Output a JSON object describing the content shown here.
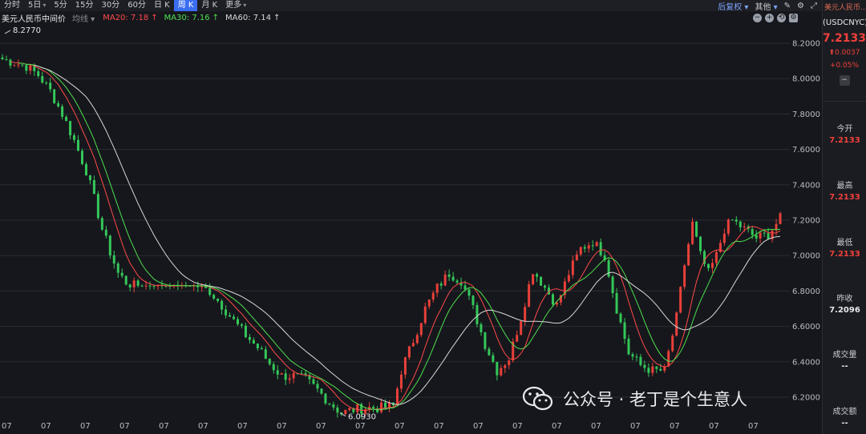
{
  "toolbar": {
    "items": [
      {
        "label": "分时",
        "caret": false,
        "active": false
      },
      {
        "label": "5日",
        "caret": true,
        "active": false
      },
      {
        "label": "5分",
        "caret": false,
        "active": false
      },
      {
        "label": "15分",
        "caret": false,
        "active": false
      },
      {
        "label": "30分",
        "caret": false,
        "active": false
      },
      {
        "label": "60分",
        "caret": false,
        "active": false
      },
      {
        "label": "日 K",
        "caret": false,
        "active": false
      },
      {
        "label": "周 K",
        "caret": false,
        "active": true
      },
      {
        "label": "月 K",
        "caret": false,
        "active": false
      },
      {
        "label": "更多",
        "caret": true,
        "active": false
      }
    ],
    "fuquan": "后复权",
    "other": "其他"
  },
  "legend": {
    "name": "美元人民币中间价",
    "avg": "均线",
    "ma": [
      {
        "label": "MA20: 7.18",
        "arrow": "↑",
        "color": "#ff4a4a"
      },
      {
        "label": "MA30: 7.16",
        "arrow": "↑",
        "color": "#4ee04e"
      },
      {
        "label": "MA60: 7.14",
        "arrow": "↑",
        "color": "#d8d8d8"
      }
    ]
  },
  "sidebar": {
    "name": "美元人民币...",
    "code": "(USDCNYC)",
    "price": "7.2133",
    "change": "⬆0.0037",
    "change_pct": "+0.05%",
    "fields": [
      {
        "label": "今开",
        "value": "7.2133",
        "color": "red"
      },
      {
        "label": "最高",
        "value": "7.2133",
        "color": "red"
      },
      {
        "label": "最低",
        "value": "7.2133",
        "color": "red"
      },
      {
        "label": "昨收",
        "value": "7.2096",
        "color": "white"
      },
      {
        "label": "成交量",
        "value": "--",
        "color": "white"
      },
      {
        "label": "成交额",
        "value": "--",
        "color": "white"
      }
    ]
  },
  "watermark": "公众号 · 老丁是个生意人",
  "colors": {
    "up": "#e8403a",
    "down": "#34c759",
    "ma20": "#ff4a4a",
    "ma30": "#4ee04e",
    "ma60": "#d8d8d8",
    "bg": "#16171c",
    "grid": "#2a2c33"
  },
  "chart_data": {
    "type": "candlestick",
    "ylim": [
      6.06,
      8.3
    ],
    "y_ticks": [
      "8.2000",
      "8.0000",
      "7.8000",
      "7.6000",
      "7.4000",
      "7.2000",
      "7.0000",
      "6.8000",
      "6.6000",
      "6.4000",
      "6.2000"
    ],
    "x_ticks": [
      "07",
      "07",
      "07",
      "07",
      "07",
      "07",
      "07",
      "07",
      "07",
      "07",
      "07",
      "07",
      "07",
      "07",
      "07",
      "07",
      "07",
      "07",
      "07",
      "07"
    ],
    "annotations": [
      {
        "label": "8.2770",
        "value": 8.277,
        "marker": "max"
      },
      {
        "label": "6.0930",
        "value": 6.093,
        "marker": "min"
      }
    ],
    "close_path": [
      [
        0,
        8.11
      ],
      [
        3,
        8.09
      ],
      [
        6,
        8.07
      ],
      [
        9,
        8.02
      ],
      [
        12,
        7.93
      ],
      [
        15,
        7.8
      ],
      [
        18,
        7.65
      ],
      [
        21,
        7.48
      ],
      [
        23,
        7.32
      ],
      [
        25,
        7.15
      ],
      [
        27,
        7.02
      ],
      [
        29,
        6.9
      ],
      [
        31,
        6.85
      ],
      [
        33,
        6.83
      ],
      [
        40,
        6.83
      ],
      [
        48,
        6.83
      ],
      [
        52,
        6.8
      ],
      [
        55,
        6.72
      ],
      [
        58,
        6.63
      ],
      [
        61,
        6.55
      ],
      [
        64,
        6.48
      ],
      [
        67,
        6.39
      ],
      [
        70,
        6.32
      ],
      [
        73,
        6.32
      ],
      [
        76,
        6.3
      ],
      [
        79,
        6.24
      ],
      [
        82,
        6.17
      ],
      [
        85,
        6.11
      ],
      [
        88,
        6.13
      ],
      [
        91,
        6.14
      ],
      [
        95,
        6.14
      ],
      [
        98,
        6.15
      ],
      [
        100,
        6.35
      ],
      [
        103,
        6.52
      ],
      [
        106,
        6.7
      ],
      [
        109,
        6.82
      ],
      [
        112,
        6.9
      ],
      [
        115,
        6.86
      ],
      [
        118,
        6.7
      ],
      [
        121,
        6.5
      ],
      [
        124,
        6.35
      ],
      [
        127,
        6.42
      ],
      [
        130,
        6.65
      ],
      [
        133,
        6.92
      ],
      [
        136,
        6.82
      ],
      [
        139,
        6.72
      ],
      [
        142,
        6.9
      ],
      [
        145,
        7.04
      ],
      [
        148,
        7.08
      ],
      [
        151,
        7.0
      ],
      [
        154,
        6.7
      ],
      [
        157,
        6.45
      ],
      [
        160,
        6.38
      ],
      [
        163,
        6.35
      ],
      [
        166,
        6.35
      ],
      [
        169,
        6.65
      ],
      [
        171,
        6.95
      ],
      [
        173,
        7.18
      ],
      [
        175,
        7.0
      ],
      [
        177,
        6.9
      ],
      [
        179,
        7.0
      ],
      [
        181,
        7.15
      ],
      [
        183,
        7.2
      ],
      [
        186,
        7.15
      ],
      [
        189,
        7.1
      ],
      [
        192,
        7.12
      ],
      [
        195,
        7.21
      ]
    ],
    "series": [
      {
        "name": "MA20",
        "value": 7.18
      },
      {
        "name": "MA30",
        "value": 7.16
      },
      {
        "name": "MA60",
        "value": 7.14
      }
    ]
  }
}
